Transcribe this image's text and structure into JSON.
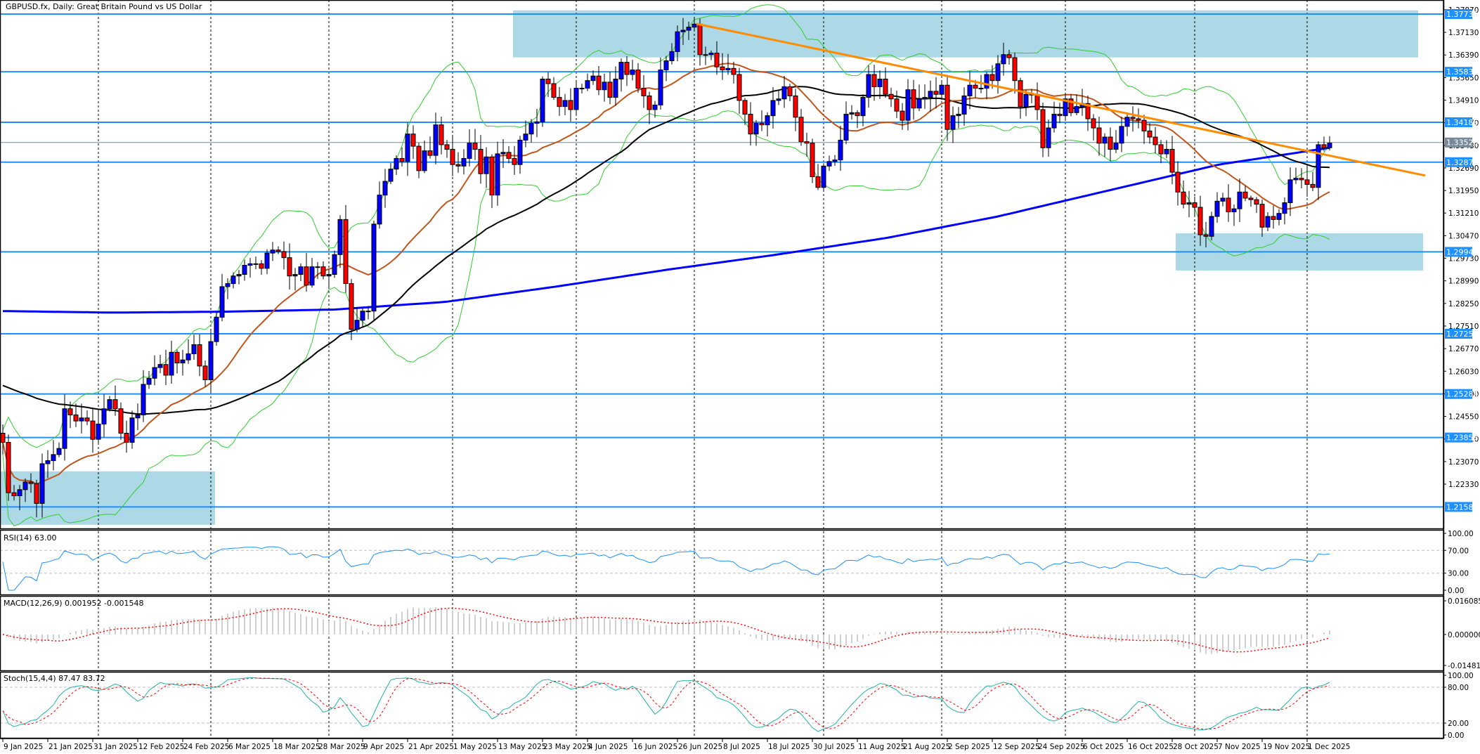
{
  "header": {
    "title": "GBPUSD.fx, Daily:  Great Britain Pound vs US Dollar"
  },
  "colors": {
    "bull": "#0000ff",
    "bear": "#ff0000",
    "level_line": "#1e90ff",
    "zone": "#add8e6",
    "ma200": "#0000ff",
    "ma50": "#000000",
    "ma20": "#c0561c",
    "bollinger": "#32cd32",
    "trendline": "#ff8c00",
    "current_price": "#778899",
    "rsi": "#1e90ff",
    "macd_hist": "#c0c0c0",
    "macd_signal": "#ff0000",
    "stoch_main": "#20b2aa",
    "stoch_signal": "#ff0000"
  },
  "chart_data": [
    {
      "type": "candlestick",
      "symbol": "GBPUSD.fx",
      "timeframe": "Daily",
      "ylim": [
        1.2088,
        1.3819
      ],
      "grid": "vertical dashed month separators",
      "x_tick_labels": [
        "9 Jan 2025",
        "21 Jan 2025",
        "31 Jan 2025",
        "12 Feb 2025",
        "24 Feb 2025",
        "6 Mar 2025",
        "18 Mar 2025",
        "28 Mar 2025",
        "9 Apr 2025",
        "21 Apr 2025",
        "1 May 2025",
        "13 May 2025",
        "23 May 2025",
        "4 Jun 2025",
        "16 Jun 2025",
        "26 Jun 2025",
        "8 Jul 2025",
        "18 Jul 2025",
        "30 Jul 2025",
        "11 Aug 2025",
        "21 Aug 2025",
        "2 Sep 2025",
        "12 Sep 2025",
        "24 Sep 2025",
        "6 Oct 2025",
        "16 Oct 2025",
        "28 Oct 2025",
        "7 Nov 2025",
        "19 Nov 2025",
        "1 Dec 2025"
      ],
      "y_tick_labels": [
        "1.37870",
        "1.37130",
        "1.36390",
        "1.35650",
        "1.34910",
        "1.34170",
        "1.33430",
        "1.32690",
        "1.31950",
        "1.31210",
        "1.30470",
        "1.29730",
        "1.28990",
        "1.28250",
        "1.27510",
        "1.26770",
        "1.26030",
        "1.25290",
        "1.24550",
        "1.23810",
        "1.23070",
        "1.22330"
      ],
      "closes": [
        1.237,
        1.2205,
        1.2195,
        1.2215,
        1.224,
        1.2235,
        1.217,
        1.23,
        1.231,
        1.233,
        1.235,
        1.248,
        1.246,
        1.244,
        1.245,
        1.244,
        1.238,
        1.243,
        1.248,
        1.251,
        1.248,
        1.24,
        1.237,
        1.245,
        1.246,
        1.256,
        1.258,
        1.2615,
        1.2625,
        1.259,
        1.2665,
        1.263,
        1.264,
        1.266,
        1.269,
        1.262,
        1.2575,
        1.27,
        1.278,
        1.288,
        1.289,
        1.2915,
        1.292,
        1.295,
        1.2955,
        1.2955,
        1.294,
        1.299,
        1.3,
        1.2995,
        1.2975,
        1.2915,
        1.292,
        1.2945,
        1.2885,
        1.2945,
        1.2945,
        1.2915,
        1.292,
        1.2985,
        1.31,
        1.289,
        1.274,
        1.277,
        1.28,
        1.28,
        1.3085,
        1.318,
        1.3225,
        1.3265,
        1.33,
        1.329,
        1.338,
        1.334,
        1.326,
        1.3325,
        1.331,
        1.341,
        1.3345,
        1.333,
        1.328,
        1.3275,
        1.33,
        1.335,
        1.333,
        1.325,
        1.3305,
        1.318,
        1.3315,
        1.332,
        1.33,
        1.328,
        1.336,
        1.338,
        1.3415,
        1.342,
        1.356,
        1.3545,
        1.35,
        1.347,
        1.349,
        1.346,
        1.353,
        1.353,
        1.3555,
        1.357,
        1.3525,
        1.355,
        1.35,
        1.356,
        1.3615,
        1.3575,
        1.359,
        1.353,
        1.3505,
        1.346,
        1.3475,
        1.359,
        1.362,
        1.365,
        1.3715,
        1.372,
        1.373,
        1.374,
        1.364,
        1.364,
        1.3645,
        1.36,
        1.359,
        1.3595,
        1.3575,
        1.349,
        1.3445,
        1.338,
        1.3415,
        1.341,
        1.344,
        1.349,
        1.3495,
        1.3535,
        1.3505,
        1.3435,
        1.3355,
        1.335,
        1.324,
        1.3205,
        1.3275,
        1.329,
        1.3295,
        1.336,
        1.3445,
        1.345,
        1.344,
        1.35,
        1.3575,
        1.3535,
        1.356,
        1.351,
        1.3495,
        1.3455,
        1.3425,
        1.3525,
        1.3465,
        1.3495,
        1.35,
        1.352,
        1.351,
        1.354,
        1.3395,
        1.344,
        1.3445,
        1.3505,
        1.354,
        1.353,
        1.353,
        1.3575,
        1.3555,
        1.361,
        1.364,
        1.363,
        1.3555,
        1.347,
        1.351,
        1.351,
        1.346,
        1.3335,
        1.34,
        1.3445,
        1.344,
        1.3495,
        1.345,
        1.347,
        1.348,
        1.343,
        1.34,
        1.335,
        1.337,
        1.333,
        1.335,
        1.3405,
        1.3435,
        1.343,
        1.3425,
        1.339,
        1.337,
        1.3345,
        1.3315,
        1.333,
        1.3255,
        1.319,
        1.315,
        1.3155,
        1.314,
        1.305,
        1.3045,
        1.311,
        1.316,
        1.317,
        1.3125,
        1.3135,
        1.319,
        1.317,
        1.3165,
        1.315,
        1.3075,
        1.311,
        1.31,
        1.312,
        1.3155,
        1.323,
        1.3235,
        1.323,
        1.3215,
        1.3205,
        1.3345,
        1.3335,
        1.335
      ],
      "ma200_samples": [
        1.28,
        1.2795,
        1.2798,
        1.2805,
        1.283,
        1.288,
        1.2935,
        1.2985,
        1.304,
        1.311,
        1.3195,
        1.328,
        1.3335
      ],
      "levels": [
        "1.37731",
        "1.35838",
        "1.34186",
        "1.32878",
        "1.29940",
        "1.27257",
        "1.25284",
        "1.23858",
        "1.21585"
      ],
      "current_price": "1.33523",
      "zones": [
        {
          "high": 1.3785,
          "low": 1.3631
        },
        {
          "high": 1.3055,
          "low": 1.2933
        },
        {
          "high": 1.2275,
          "low": 1.21
        }
      ],
      "trendline": {
        "start_price": 1.3741,
        "end_price": 1.3244
      }
    },
    {
      "type": "line",
      "title": "RSI(14) 63.00",
      "ylim": [
        0,
        100
      ],
      "y_tick_labels": [
        "100.00",
        "70.00",
        "30.00",
        "0.00"
      ],
      "levels": [
        70,
        30
      ]
    },
    {
      "type": "bar",
      "title": "MACD(12,26,9) 0.001952 -0.001548",
      "ylim": [
        -0.014818,
        0.016085
      ],
      "y_tick_labels": [
        "0.016085",
        "0.000000",
        "-0.014818"
      ]
    },
    {
      "type": "line",
      "title": "Stoch(15,4,4) 87.47 83.72",
      "ylim": [
        0,
        100
      ],
      "y_tick_labels": [
        "100.00",
        "80.00",
        "20.00",
        "0.00"
      ],
      "levels": [
        80,
        20
      ]
    }
  ]
}
